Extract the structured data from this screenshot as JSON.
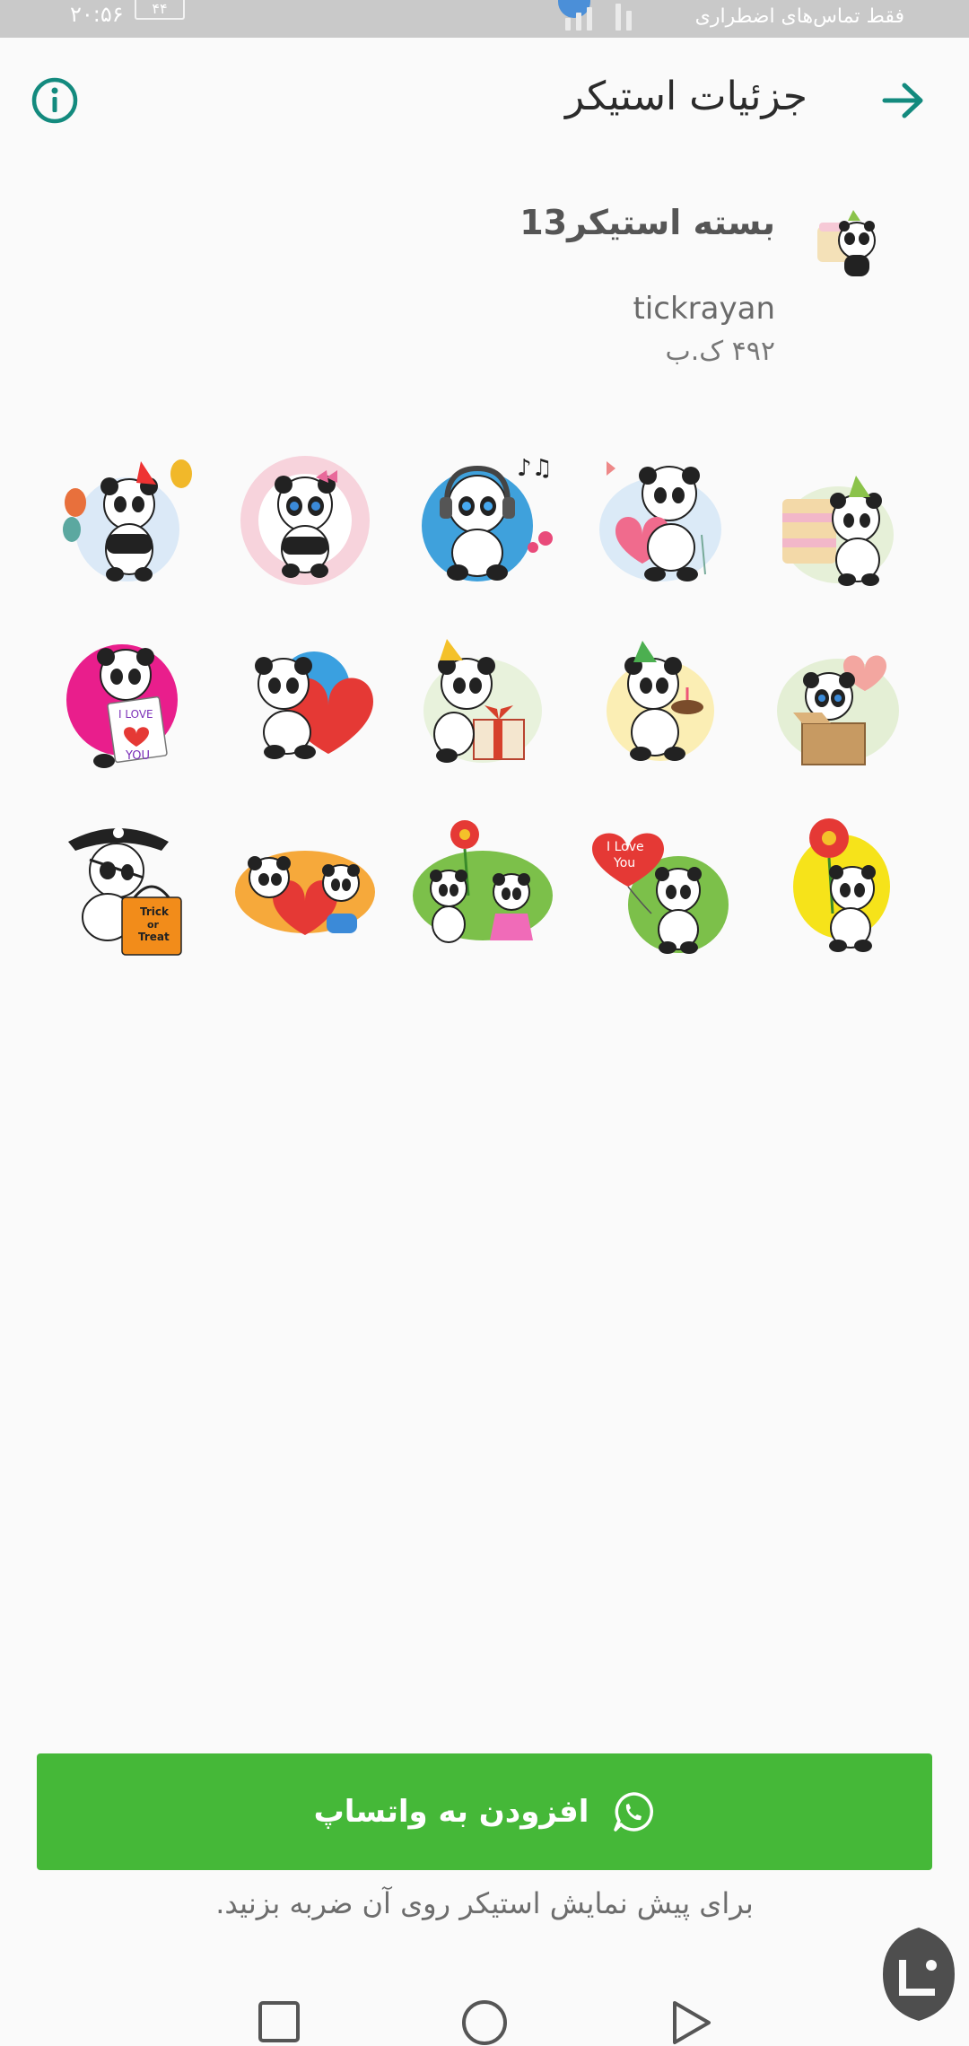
{
  "status_bar": {
    "carrier_text": "فقط تماس‌های اضطراری",
    "time": "۲۰:۵۶",
    "battery": "۴۴"
  },
  "header": {
    "title": "جزئیات استیکر",
    "back_icon": "arrow-right-icon",
    "info_icon": "info-circle-icon"
  },
  "pack": {
    "title": "بسته استیکر13",
    "publisher": "tickrayan",
    "size": "۴۹۲ ک.ب"
  },
  "stickers": [
    {
      "name": "panda-balloons-sticker"
    },
    {
      "name": "panda-pink-flowers-sticker"
    },
    {
      "name": "panda-headphones-sticker"
    },
    {
      "name": "panda-heart-butterfly-sticker"
    },
    {
      "name": "panda-cake-party-hat-sticker"
    },
    {
      "name": "panda-i-love-you-sign-sticker"
    },
    {
      "name": "panda-red-heart-sticker"
    },
    {
      "name": "panda-gift-box-sticker"
    },
    {
      "name": "panda-birthday-cake-sticker"
    },
    {
      "name": "panda-box-heart-balloon-sticker"
    },
    {
      "name": "panda-pirate-trick-or-treat-sticker"
    },
    {
      "name": "panda-couple-heart-sticker"
    },
    {
      "name": "panda-couple-flower-sticker"
    },
    {
      "name": "panda-i-love-you-balloon-sticker"
    },
    {
      "name": "panda-red-flower-sticker"
    }
  ],
  "sticker_texts": {
    "love_sign_top": "I LOVE",
    "love_sign_bottom": "YOU",
    "trick_line1": "Trick",
    "trick_line2": "or",
    "trick_line3": "Treat",
    "balloon_line1": "I Love",
    "balloon_line2": "You"
  },
  "add_button": {
    "label": "افزودن به واتساپ",
    "icon": "whatsapp-icon"
  },
  "hint": "برای پیش نمایش استیکر روی آن ضربه بزنید.",
  "nav_bar": {
    "recent_icon": "square-recents-icon",
    "home_icon": "circle-home-icon",
    "back_icon": "triangle-back-icon"
  },
  "colors": {
    "accent": "#138a7e",
    "button_green": "#45b838",
    "background": "#fafafa"
  }
}
